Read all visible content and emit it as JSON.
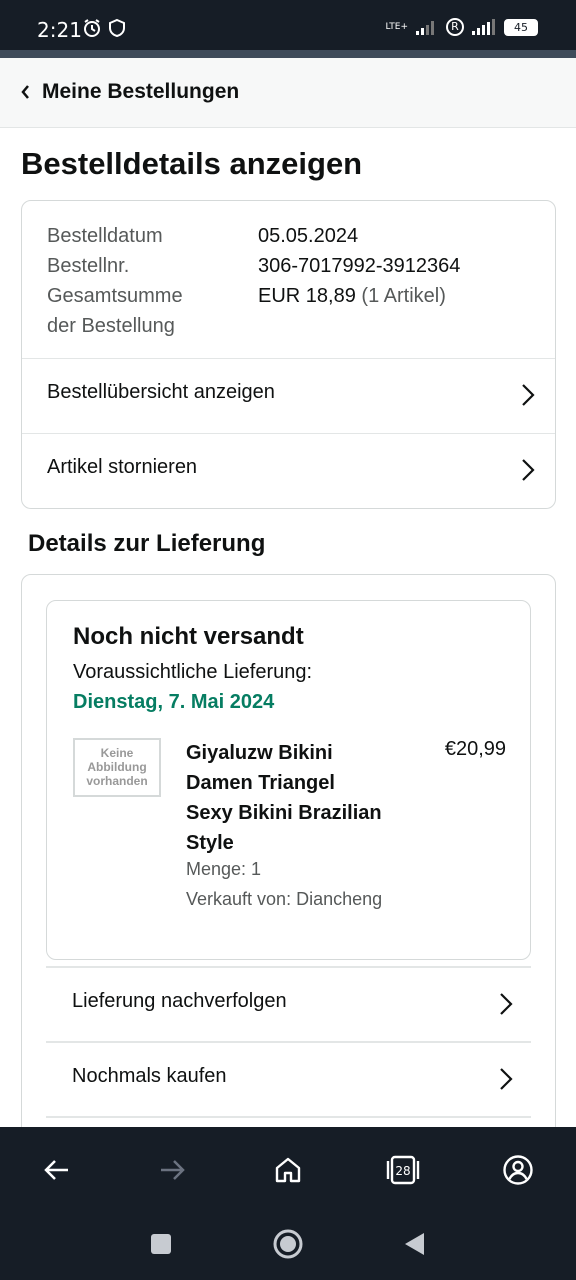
{
  "status_bar": {
    "time": "2:21",
    "network": "LTE+",
    "roaming": "R",
    "battery": "45"
  },
  "header": {
    "back_label": "Meine Bestellungen"
  },
  "page": {
    "title": "Bestelldetails anzeigen"
  },
  "order": {
    "date_label": "Bestelldatum",
    "date_value": "05.05.2024",
    "number_label": "Bestellnr.",
    "number_value": "306-7017992-3912364",
    "total_label_line1": "Gesamtsumme",
    "total_label_line2": "der Bestellung",
    "total_value": "EUR 18,89",
    "total_items": "(1 Artikel)",
    "links": [
      {
        "label": "Bestellübersicht anzeigen"
      },
      {
        "label": "Artikel stornieren"
      }
    ]
  },
  "delivery": {
    "section_title": "Details zur Lieferung",
    "status": "Noch nicht versandt",
    "eta_label": "Voraussichtliche Lieferung:",
    "eta_date": "Dienstag, 7. Mai 2024",
    "item": {
      "no_image_line1": "Keine",
      "no_image_line2": "Abbildung",
      "no_image_line3": "vorhanden",
      "title": "Giyaluzw Bikini Damen Triangel Sexy Bikini Brazilian Style",
      "price": "€20,99",
      "quantity": "Menge: 1",
      "seller": "Verkauft von: Diancheng"
    },
    "links": [
      {
        "label": "Lieferung nachverfolgen"
      },
      {
        "label": "Nochmals kaufen"
      }
    ]
  },
  "browser_bar": {
    "tab_count": "28"
  },
  "colors": {
    "status_bar_bg": "#161d26",
    "eta_green": "#067d62",
    "text_primary": "#0f1111",
    "text_secondary": "#565959"
  }
}
